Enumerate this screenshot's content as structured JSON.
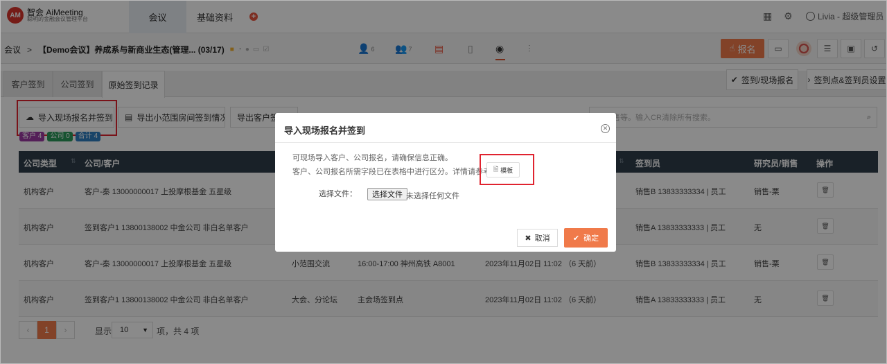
{
  "brand": {
    "name": "智会 AiMeeting",
    "subtitle": "聪明的金融会议管理平台",
    "mark": "AM"
  },
  "nav": {
    "tabs": [
      "会议",
      "基础资料"
    ],
    "plus": "+"
  },
  "user": {
    "label": "Livia - 超级管理员"
  },
  "breadcrumb": {
    "root": "会议",
    "sep": ">",
    "meeting": "【Demo会议】养成系与新商业生态(管理... (03/17)"
  },
  "modules": [
    {
      "icon": "user-icon",
      "count": "6"
    },
    {
      "icon": "users-icon",
      "count": "7"
    },
    {
      "icon": "calendar-icon",
      "count": ""
    },
    {
      "icon": "tablet-icon",
      "count": ""
    },
    {
      "icon": "location-icon",
      "count": ""
    },
    {
      "icon": "chart-icon",
      "count": ""
    }
  ],
  "toolbar": {
    "signup_label": "报名"
  },
  "subtabs": [
    "客户签到",
    "公司签到",
    "原始签到记录"
  ],
  "right_buttons": {
    "signin_signup": "签到/现场报名",
    "signin_settings": "签到点&签到员设置"
  },
  "actions": {
    "import": "导入现场报名并签到",
    "export_small": "导出小范围房间签到情况",
    "export_client": "导出客户签到"
  },
  "search": {
    "placeholder": "员/销售等。输入CR清除所有搜索。"
  },
  "badges": [
    {
      "label": "客户 4",
      "color": "#9b3aa3"
    },
    {
      "label": "公司 0",
      "color": "#2c9a5b"
    },
    {
      "label": "合计 4",
      "color": "#2f7fc0"
    }
  ],
  "table": {
    "headers": {
      "company_type": "公司类型",
      "company_client": "公司/客户",
      "signer": "签到员",
      "researcher": "研究员/销售",
      "action": "操作"
    },
    "rows": [
      {
        "type": "机构客户",
        "client": "客户-秦 13000000017 上投摩根基金 五星级",
        "venue": "",
        "session": "",
        "time": "",
        "signer": "销售B 13833333334 | 员工",
        "researcher": "销售-栗"
      },
      {
        "type": "机构客户",
        "client": "签到客户1 13800138002 中金公司 非白名单客户",
        "venue": "",
        "session": "",
        "time": "",
        "signer": "销售A 13833333333 | 员工",
        "researcher": "无"
      },
      {
        "type": "机构客户",
        "client": "客户-秦 13000000017 上投摩根基金 五星级",
        "venue": "小范围交流",
        "session": "16:00-17:00 神州高铁 A8001",
        "time": "2023年11月02日 11:02 （6 天前）",
        "signer": "销售B 13833333334 | 员工",
        "researcher": "销售-栗"
      },
      {
        "type": "机构客户",
        "client": "签到客户1 13800138002 中金公司 非白名单客户",
        "venue": "大会、分论坛",
        "session": "主会场签到点",
        "time": "2023年11月02日 11:02 （6 天前）",
        "signer": "销售A 13833333333 | 员工",
        "researcher": "无"
      }
    ]
  },
  "pager": {
    "prev": "‹",
    "current": "1",
    "next": "›",
    "show": "显示",
    "page_size": "10",
    "total": "项，共 4 项"
  },
  "modal": {
    "title": "导入现场报名并签到",
    "line1": "可现场导入客户、公司报名，请确保信息正确。",
    "line2": "客户、公司报名所需字段已在表格中进行区分。详情请参考",
    "template": "模板",
    "file_label": "选择文件：",
    "file_button": "选择文件",
    "file_none": "未选择任何文件",
    "cancel": "取消",
    "ok": "确定"
  }
}
